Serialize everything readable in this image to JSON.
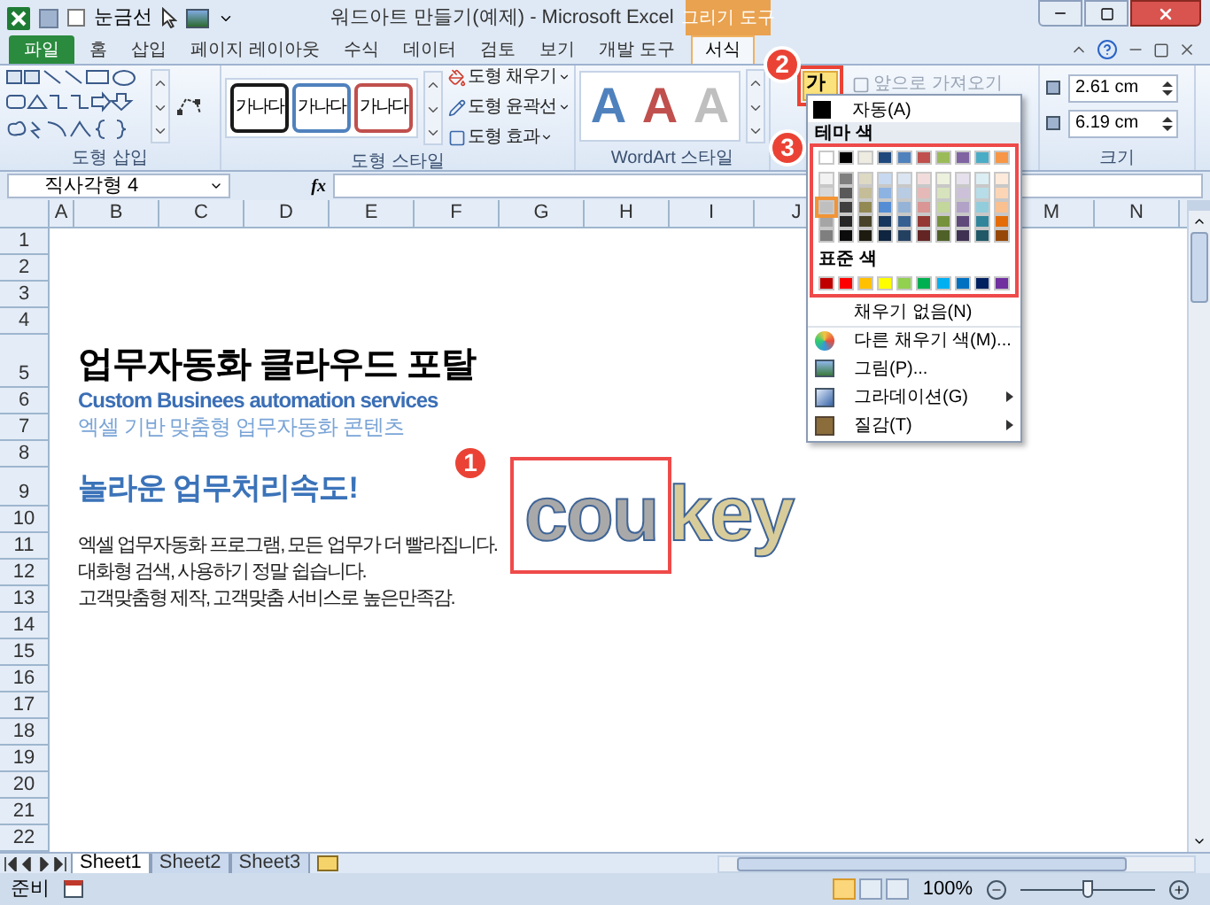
{
  "title_bar": {
    "gridlines": {
      "label": "눈금선",
      "checked": false
    },
    "title": "워드아트 만들기(예제) - Microsoft Excel",
    "context_group": "그리기 도구"
  },
  "tabs": [
    {
      "label": "파일",
      "kind": "file",
      "selected": false
    },
    {
      "label": "홈",
      "kind": "normal",
      "selected": false
    },
    {
      "label": "삽입",
      "kind": "normal",
      "selected": false
    },
    {
      "label": "페이지 레이아웃",
      "kind": "normal",
      "selected": false
    },
    {
      "label": "수식",
      "kind": "normal",
      "selected": false
    },
    {
      "label": "데이터",
      "kind": "normal",
      "selected": false
    },
    {
      "label": "검토",
      "kind": "normal",
      "selected": false
    },
    {
      "label": "보기",
      "kind": "normal",
      "selected": false
    },
    {
      "label": "개발 도구",
      "kind": "normal",
      "selected": false
    },
    {
      "label": "서식",
      "kind": "context",
      "selected": true
    }
  ],
  "ribbon": {
    "insert_shapes": {
      "label": "도형 삽입"
    },
    "shape_styles": {
      "label": "도형 스타일",
      "presets": [
        {
          "text": "가나다",
          "color": "#1a1a1a"
        },
        {
          "text": "가나다",
          "color": "#4f81bd"
        },
        {
          "text": "가나다",
          "color": "#c0504d"
        }
      ],
      "commands": [
        "도형 채우기",
        "도형 윤곽선",
        "도형 효과"
      ]
    },
    "wordart_styles": {
      "label": "WordArt 스타일",
      "presets": [
        {
          "text": "A",
          "color": "#4f81bd"
        },
        {
          "text": "A",
          "color": "#c0504d"
        },
        {
          "text": "A",
          "color": "#bfbfbf"
        }
      ]
    },
    "arrange": {
      "text_fill": {
        "text": "가",
        "highlighted": true
      },
      "bring_forward": {
        "label": "앞으로 가져오기",
        "disabled": true
      }
    },
    "size": {
      "label": "크기",
      "height": "2.61 cm",
      "width": "6.19 cm"
    }
  },
  "formula_bar": {
    "name_box": "직사각형 4",
    "function_label": "fx"
  },
  "columns": [
    "A",
    "B",
    "C",
    "D",
    "E",
    "F",
    "G",
    "H",
    "I",
    "J",
    "M",
    "N"
  ],
  "rows": [
    {
      "number": "1"
    },
    {
      "number": "2"
    },
    {
      "number": "3"
    },
    {
      "number": "4"
    },
    {
      "number": "5",
      "text": "업무자동화 클라우드 포탈",
      "kind": "title"
    },
    {
      "number": "6",
      "text": "Custom Businees automation services",
      "kind": "subtitle"
    },
    {
      "number": "7",
      "text": "엑셀 기반 맞춤형 업무자동화 콘텐츠",
      "kind": "caption"
    },
    {
      "number": "8"
    },
    {
      "number": "9",
      "text": "놀라운 업무처리속도!",
      "kind": "heading"
    },
    {
      "number": "10"
    },
    {
      "number": "11",
      "text": "엑셀 업무자동화 프로그램, 모든 업무가 더 빨라집니다.",
      "kind": "body"
    },
    {
      "number": "12",
      "text": "대화형 검색, 사용하기 정말 쉽습니다.",
      "kind": "body"
    },
    {
      "number": "13",
      "text": "고객맞춤형 제작, 고객맞춤 서비스로 높은만족감.",
      "kind": "body"
    },
    {
      "number": "14"
    },
    {
      "number": "15"
    },
    {
      "number": "16"
    },
    {
      "number": "17"
    },
    {
      "number": "18"
    },
    {
      "number": "19"
    },
    {
      "number": "20"
    },
    {
      "number": "21"
    },
    {
      "number": "22"
    }
  ],
  "wordart": {
    "segments": [
      {
        "text": "cou",
        "selected": true
      },
      {
        "text": "key",
        "selected": false
      }
    ]
  },
  "fill_menu": {
    "automatic": "자동(A)",
    "theme_header": "테마 색",
    "theme_rows": [
      {
        "swatches": [
          {
            "color": "#ffffff",
            "selected": false
          },
          {
            "color": "#000000",
            "selected": false
          },
          {
            "color": "#eeece1",
            "selected": false
          },
          {
            "color": "#1f497d",
            "selected": false
          },
          {
            "color": "#4f81bd",
            "selected": false
          },
          {
            "color": "#c0504d",
            "selected": false
          },
          {
            "color": "#9bbb59",
            "selected": false
          },
          {
            "color": "#8064a2",
            "selected": false
          },
          {
            "color": "#4bacc6",
            "selected": false
          },
          {
            "color": "#f79646",
            "selected": false
          }
        ]
      },
      {
        "swatches": [
          {
            "color": "#f2f2f2",
            "selected": false
          },
          {
            "color": "#7f7f7f",
            "selected": false
          },
          {
            "color": "#ddd9c3",
            "selected": false
          },
          {
            "color": "#c6d9f0",
            "selected": false
          },
          {
            "color": "#dbe5f1",
            "selected": false
          },
          {
            "color": "#f2dcdb",
            "selected": false
          },
          {
            "color": "#ebf1dd",
            "selected": false
          },
          {
            "color": "#e5e0ec",
            "selected": false
          },
          {
            "color": "#dbeef3",
            "selected": false
          },
          {
            "color": "#fdeada",
            "selected": false
          }
        ]
      },
      {
        "swatches": [
          {
            "color": "#d8d8d8",
            "selected": false
          },
          {
            "color": "#595959",
            "selected": false
          },
          {
            "color": "#c4bd97",
            "selected": false
          },
          {
            "color": "#8db3e2",
            "selected": false
          },
          {
            "color": "#b8cce4",
            "selected": false
          },
          {
            "color": "#e5b9b7",
            "selected": false
          },
          {
            "color": "#d7e3bc",
            "selected": false
          },
          {
            "color": "#ccc1d9",
            "selected": false
          },
          {
            "color": "#b7dde8",
            "selected": false
          },
          {
            "color": "#fbd5b5",
            "selected": false
          }
        ]
      },
      {
        "swatches": [
          {
            "color": "#bfbfbf",
            "selected": true
          },
          {
            "color": "#3f3f3f",
            "selected": false
          },
          {
            "color": "#938953",
            "selected": false
          },
          {
            "color": "#548dd4",
            "selected": false
          },
          {
            "color": "#95b3d7",
            "selected": false
          },
          {
            "color": "#d99694",
            "selected": false
          },
          {
            "color": "#c3d69b",
            "selected": false
          },
          {
            "color": "#b2a2c7",
            "selected": false
          },
          {
            "color": "#92cddc",
            "selected": false
          },
          {
            "color": "#fac08f",
            "selected": false
          }
        ]
      },
      {
        "swatches": [
          {
            "color": "#a5a5a5",
            "selected": false
          },
          {
            "color": "#262626",
            "selected": false
          },
          {
            "color": "#494429",
            "selected": false
          },
          {
            "color": "#17365d",
            "selected": false
          },
          {
            "color": "#366092",
            "selected": false
          },
          {
            "color": "#953734",
            "selected": false
          },
          {
            "color": "#76923c",
            "selected": false
          },
          {
            "color": "#5f497a",
            "selected": false
          },
          {
            "color": "#31859b",
            "selected": false
          },
          {
            "color": "#e36c09",
            "selected": false
          }
        ]
      },
      {
        "swatches": [
          {
            "color": "#7f7f7f",
            "selected": false
          },
          {
            "color": "#0c0c0c",
            "selected": false
          },
          {
            "color": "#1d1b10",
            "selected": false
          },
          {
            "color": "#0f243e",
            "selected": false
          },
          {
            "color": "#244061",
            "selected": false
          },
          {
            "color": "#632423",
            "selected": false
          },
          {
            "color": "#4f6128",
            "selected": false
          },
          {
            "color": "#3f3151",
            "selected": false
          },
          {
            "color": "#205867",
            "selected": false
          },
          {
            "color": "#974806",
            "selected": false
          }
        ]
      }
    ],
    "standard_header": "표준 색",
    "standard": [
      {
        "color": "#c00000",
        "selected": false
      },
      {
        "color": "#ff0000",
        "selected": false
      },
      {
        "color": "#ffc000",
        "selected": false
      },
      {
        "color": "#ffff00",
        "selected": false
      },
      {
        "color": "#92d050",
        "selected": false
      },
      {
        "color": "#00b050",
        "selected": false
      },
      {
        "color": "#00b0f0",
        "selected": false
      },
      {
        "color": "#0070c0",
        "selected": false
      },
      {
        "color": "#002060",
        "selected": false
      },
      {
        "color": "#7030a0",
        "selected": false
      }
    ],
    "items": [
      {
        "label": "채우기 없음(N)",
        "kind": "none",
        "submenu": false
      },
      {
        "label": "다른 채우기 색(M)...",
        "kind": "palette",
        "submenu": false
      },
      {
        "label": "그림(P)...",
        "kind": "picture",
        "submenu": false
      },
      {
        "label": "그라데이션(G)",
        "kind": "gradient",
        "submenu": true
      },
      {
        "label": "질감(T)",
        "kind": "texture",
        "submenu": true
      }
    ]
  },
  "callouts": [
    "1",
    "2",
    "3"
  ],
  "sheet_tabs": [
    {
      "label": "Sheet1",
      "selected": true
    },
    {
      "label": "Sheet2",
      "selected": false
    },
    {
      "label": "Sheet3",
      "selected": false
    }
  ],
  "status_bar": {
    "text": "준비",
    "views": [
      {
        "selected": true
      },
      {
        "selected": false
      },
      {
        "selected": false
      }
    ],
    "zoom": "100%",
    "zoom_slider": {
      "level": 0.5
    }
  }
}
